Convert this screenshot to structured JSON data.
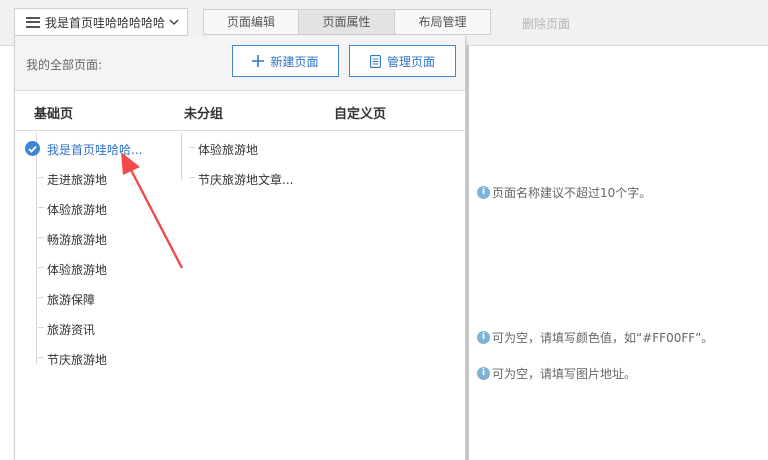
{
  "toolbar": {
    "current_page": "我是首页哇哈哈哈哈哈",
    "tabs": [
      {
        "label": "页面编辑",
        "active": false
      },
      {
        "label": "页面属性",
        "active": true
      },
      {
        "label": "布局管理",
        "active": false
      }
    ],
    "delete_label": "删除页面"
  },
  "dropdown": {
    "all_pages_label": "我的全部页面:",
    "new_button": "新建页面",
    "manage_button": "管理页面",
    "columns": {
      "basic": "基础页",
      "ungrouped": "未分组",
      "custom": "自定义页"
    },
    "basic_items": [
      {
        "label": "我是首页哇哈哈...",
        "selected": true
      },
      {
        "label": "走进旅游地",
        "selected": false
      },
      {
        "label": "体验旅游地",
        "selected": false
      },
      {
        "label": "畅游旅游地",
        "selected": false
      },
      {
        "label": "体验旅游地",
        "selected": false
      },
      {
        "label": "旅游保障",
        "selected": false
      },
      {
        "label": "旅游资讯",
        "selected": false
      },
      {
        "label": "节庆旅游地",
        "selected": false
      }
    ],
    "ungrouped_items": [
      {
        "label": "体验旅游地"
      },
      {
        "label": "节庆旅游地文章..."
      }
    ]
  },
  "hints": {
    "name_hint": "页面名称建议不超过10个字。",
    "color_hint": "可为空，请填写颜色值，如“#FF00FF”。",
    "image_hint": "可为空，请填写图片地址。"
  },
  "colors": {
    "accent": "#3f86d2",
    "annotation_arrow": "#f04a4a",
    "info_icon": "#7fb3d8"
  }
}
